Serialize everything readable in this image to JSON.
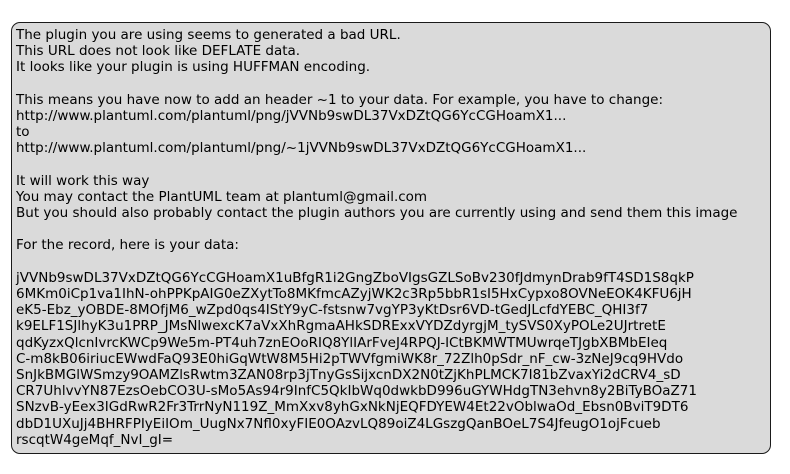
{
  "message": {
    "intro": [
      "The plugin you are using seems to generated a bad URL.",
      "This URL does not look like DEFLATE data.",
      "It looks like your plugin is using HUFFMAN encoding."
    ],
    "fix": [
      "This means you have now to add an header ~1 to your data. For example, you have to change:",
      "http://www.plantuml.com/plantuml/png/jVVNb9swDL37VxDZtQG6YcCGHoamX1...",
      "to",
      "http://www.plantuml.com/plantuml/png/~1jVVNb9swDL37VxDZtQG6YcCGHoamX1..."
    ],
    "contact": [
      "It will work this way",
      "You may contact the PlantUML team at plantuml@gmail.com",
      "But you should also probably contact the plugin authors you are currently using and send them this image"
    ],
    "record_label": "For the record, here is your data:",
    "data_lines": [
      "jVVNb9swDL37VxDZtQG6YcCGHoamX1uBfgR1i2GngZboVIgsGZLSoBv230fJdmynDrab9fT4SD1S8qkP",
      "6MKm0iCp1va1IhN-ohPPKpAIG0eZXytTo8MKfmcAZyjWK2c3Rp5bbR1sI5HxCypxo8OVNeEOK4KFU6jH",
      "eK5-Ebz_yOBDE-8MOfjM6_wZpd0qs4IStY9yC-fstsnw7vgYP3yKtDsr6VD-tGedJLcfdYEBC_QHI3f7",
      "k9ELF1SJlhyK3u1PRP_JMsNlwexcK7aVxXhRgmaAHkSDRExxVYDZdyrgjM_tySVS0XyPOLe2UJrtretE",
      "qdKyzxQlcnIvrcKWCp9We5m-PT4uh7znEOoRIQ8YlIArFveJ4RPQJ-ICtBKMWTMUwrqeTJgbXBMbEIeq",
      "C-m8kB06iriucEWwdFaQ93E0hiGqWtW8M5Hi2pTWVfgmiWK8r_72Zlh0pSdr_nF_cw-3zNeJ9cq9HVdo",
      "SnJkBMGlWSmzy9OAMZlsRwtm3ZAN08rp3jTnyGsSijxcnDX2N0tZjKhPLMCK7I81bZvaxYi2dCRV4_sD",
      "CR7UhlvvYN87EzsOebCO3U-sMo5As94r9InfC5QkIbWq0dwkbD996uGYWHdgTN3ehvn8y2BiTyBOaZ71",
      "SNzvB-yEex3IGdRwR2Fr3TrrNyN119Z_MmXxv8yhGxNkNjEQFDYEW4Et22vOblwaOd_Ebsn0BviT9DT6",
      "dbD1UXuJj4BHRFPIyEiIOm_UugNx7Nfl0xyFIE0OAzvLQ89oiZ4LGszgQanBOeL7S4JfeugO1ojFcueb",
      "rscqtW4geMqf_NvI_gI="
    ]
  }
}
